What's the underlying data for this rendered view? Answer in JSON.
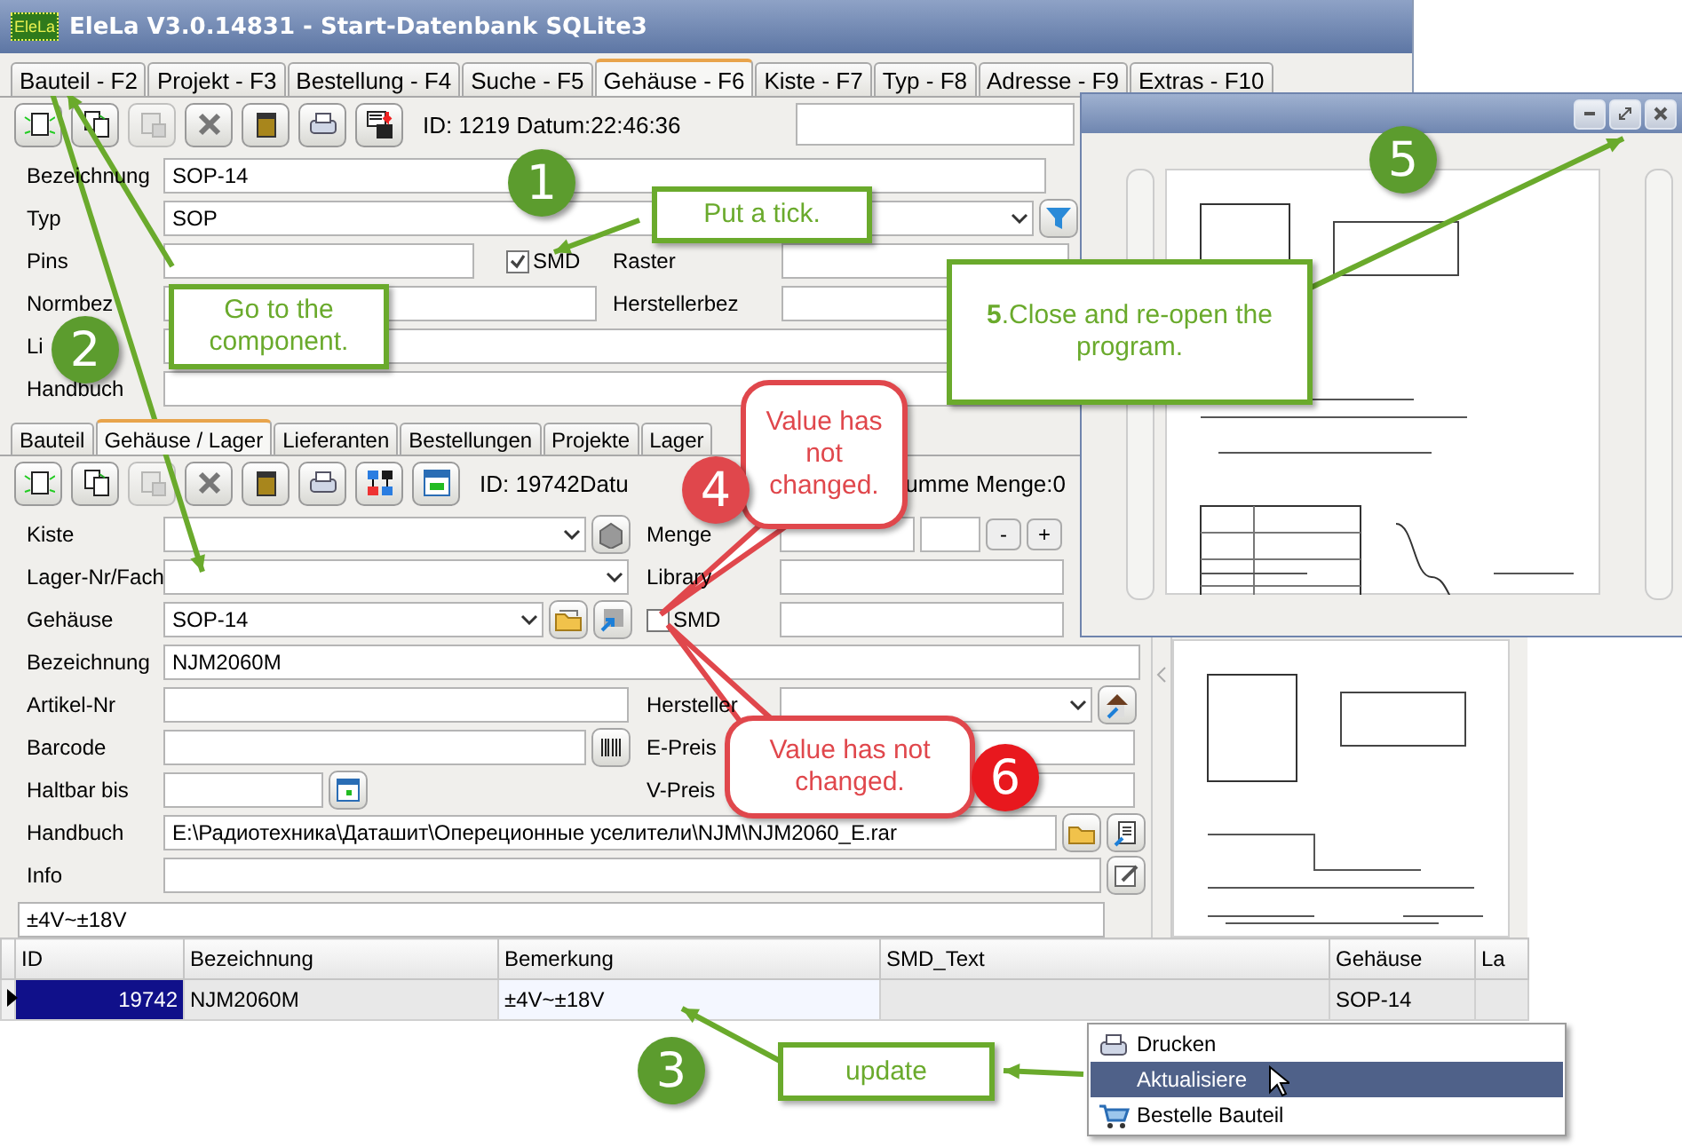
{
  "window": {
    "logo": "EleLa",
    "title": "EleLa V3.0.14831  - Start-Datenbank SQLite3"
  },
  "tabs": [
    {
      "label": "Bauteil - F2",
      "selected": false
    },
    {
      "label": "Projekt - F3",
      "selected": false
    },
    {
      "label": "Bestellung - F4",
      "selected": false
    },
    {
      "label": "Suche - F5",
      "selected": false
    },
    {
      "label": "Gehäuse - F6",
      "selected": true
    },
    {
      "label": "Kiste - F7",
      "selected": false
    },
    {
      "label": "Typ - F8",
      "selected": false
    },
    {
      "label": "Adresse - F9",
      "selected": false
    },
    {
      "label": "Extras - F10",
      "selected": false
    }
  ],
  "toolbar": {
    "buttons": [
      {
        "kind": "new",
        "disabled": false
      },
      {
        "kind": "copy",
        "disabled": false
      },
      {
        "kind": "paste",
        "disabled": true
      },
      {
        "kind": "delete",
        "disabled": false
      },
      {
        "kind": "jar",
        "disabled": false
      },
      {
        "kind": "print",
        "disabled": false
      },
      {
        "kind": "save",
        "disabled": false
      }
    ],
    "info": "ID: 1219  Datum:22:46:36"
  },
  "part_form": {
    "bezeichnung": {
      "label": "Bezeichnung",
      "value": "SOP-14"
    },
    "typ": {
      "label": "Typ",
      "value": "SOP"
    },
    "pins": {
      "label": "Pins"
    },
    "smd": {
      "label": "SMD",
      "checked": true
    },
    "raster": {
      "label": "Raster"
    },
    "normbez": {
      "label": "Normbez"
    },
    "herstellerbez": {
      "label": "Herstellerbez"
    },
    "library": {
      "label": "Li"
    },
    "handbuch": {
      "label": "Handbuch"
    }
  },
  "sub_tabs": [
    {
      "label": "Bauteil",
      "selected": false
    },
    {
      "label": "Gehäuse / Lager",
      "selected": true
    },
    {
      "label": "Lieferanten",
      "selected": false
    },
    {
      "label": "Bestellungen",
      "selected": false
    },
    {
      "label": "Projekte",
      "selected": false
    },
    {
      "label": "Lager",
      "selected": false
    }
  ],
  "sub_toolbar": {
    "buttons": [
      {
        "kind": "new",
        "disabled": false
      },
      {
        "kind": "copy",
        "disabled": false
      },
      {
        "kind": "paste",
        "disabled": true
      },
      {
        "kind": "delete",
        "disabled": false
      },
      {
        "kind": "jar",
        "disabled": false
      },
      {
        "kind": "print",
        "disabled": false
      },
      {
        "kind": "network",
        "disabled": false
      },
      {
        "kind": "table",
        "disabled": false
      }
    ],
    "info": "ID: 19742Datu",
    "info_right": "umme Menge:0"
  },
  "storage_form": {
    "kiste": {
      "label": "Kiste"
    },
    "menge": {
      "label": "Menge",
      "buttons": [
        "-",
        "+"
      ]
    },
    "lager_fach": {
      "label": "Lager-Nr/Fach"
    },
    "library": {
      "label": "Library"
    },
    "gehaeuse": {
      "label": "Gehäuse",
      "value": "SOP-14"
    },
    "smd": {
      "label": "SMD",
      "checked": false
    },
    "bezeichnung": {
      "label": "Bezeichnung",
      "value": "NJM2060M"
    },
    "artikel_nr": {
      "label": "Artikel-Nr"
    },
    "hersteller": {
      "label": "Hersteller"
    },
    "barcode": {
      "label": "Barcode"
    },
    "e_preis": {
      "label": "E-Preis"
    },
    "haltbar": {
      "label": "Haltbar bis"
    },
    "v_preis": {
      "label": "V-Preis"
    },
    "handbuch": {
      "label": "Handbuch",
      "value": "E:\\Радиотехника\\Даташит\\Опереционные уселители\\NJM\\NJM2060_E.rar"
    },
    "info": {
      "label": "Info"
    },
    "memo": "±4V~±18V"
  },
  "table": {
    "columns": [
      "ID",
      "Bezeichnung",
      "Bemerkung",
      "SMD_Text",
      "Gehäuse",
      "La"
    ],
    "rows": [
      {
        "selected": true,
        "cells": [
          "19742",
          "NJM2060M",
          "±4V~±18V",
          "",
          "SOP-14",
          ""
        ]
      }
    ]
  },
  "context_menu": [
    {
      "kind": "print",
      "label": "Drucken",
      "selected": false
    },
    {
      "kind": "plain",
      "label": "Aktualisiere",
      "selected": true
    },
    {
      "kind": "cart",
      "label": "Bestelle Bauteil",
      "selected": false
    }
  ],
  "annotations": {
    "steps": [
      {
        "label": "1",
        "color": "#5c9c2e"
      },
      {
        "label": "2",
        "color": "#5c9c2e"
      },
      {
        "label": "3",
        "color": "#5c9c2e"
      },
      {
        "label": "4",
        "color": "#e0474c"
      },
      {
        "label": "5",
        "color": "#5c9c2e"
      },
      {
        "label": "6",
        "color": "#e8181e"
      }
    ],
    "callouts": [
      {
        "text": "Put a tick.",
        "color": "#6aaa2c"
      },
      {
        "text": "Go to the component.",
        "color": "#6aaa2c"
      },
      {
        "text": "**5**.Close and re-open the program.",
        "color": "#6aaa2c"
      },
      {
        "text": "update",
        "color": "#6aaa2c"
      },
      {
        "text": "Value has not changed.",
        "color": "#e0474c"
      },
      {
        "text": "Value has not changed.",
        "color": "#e0474c"
      }
    ]
  }
}
